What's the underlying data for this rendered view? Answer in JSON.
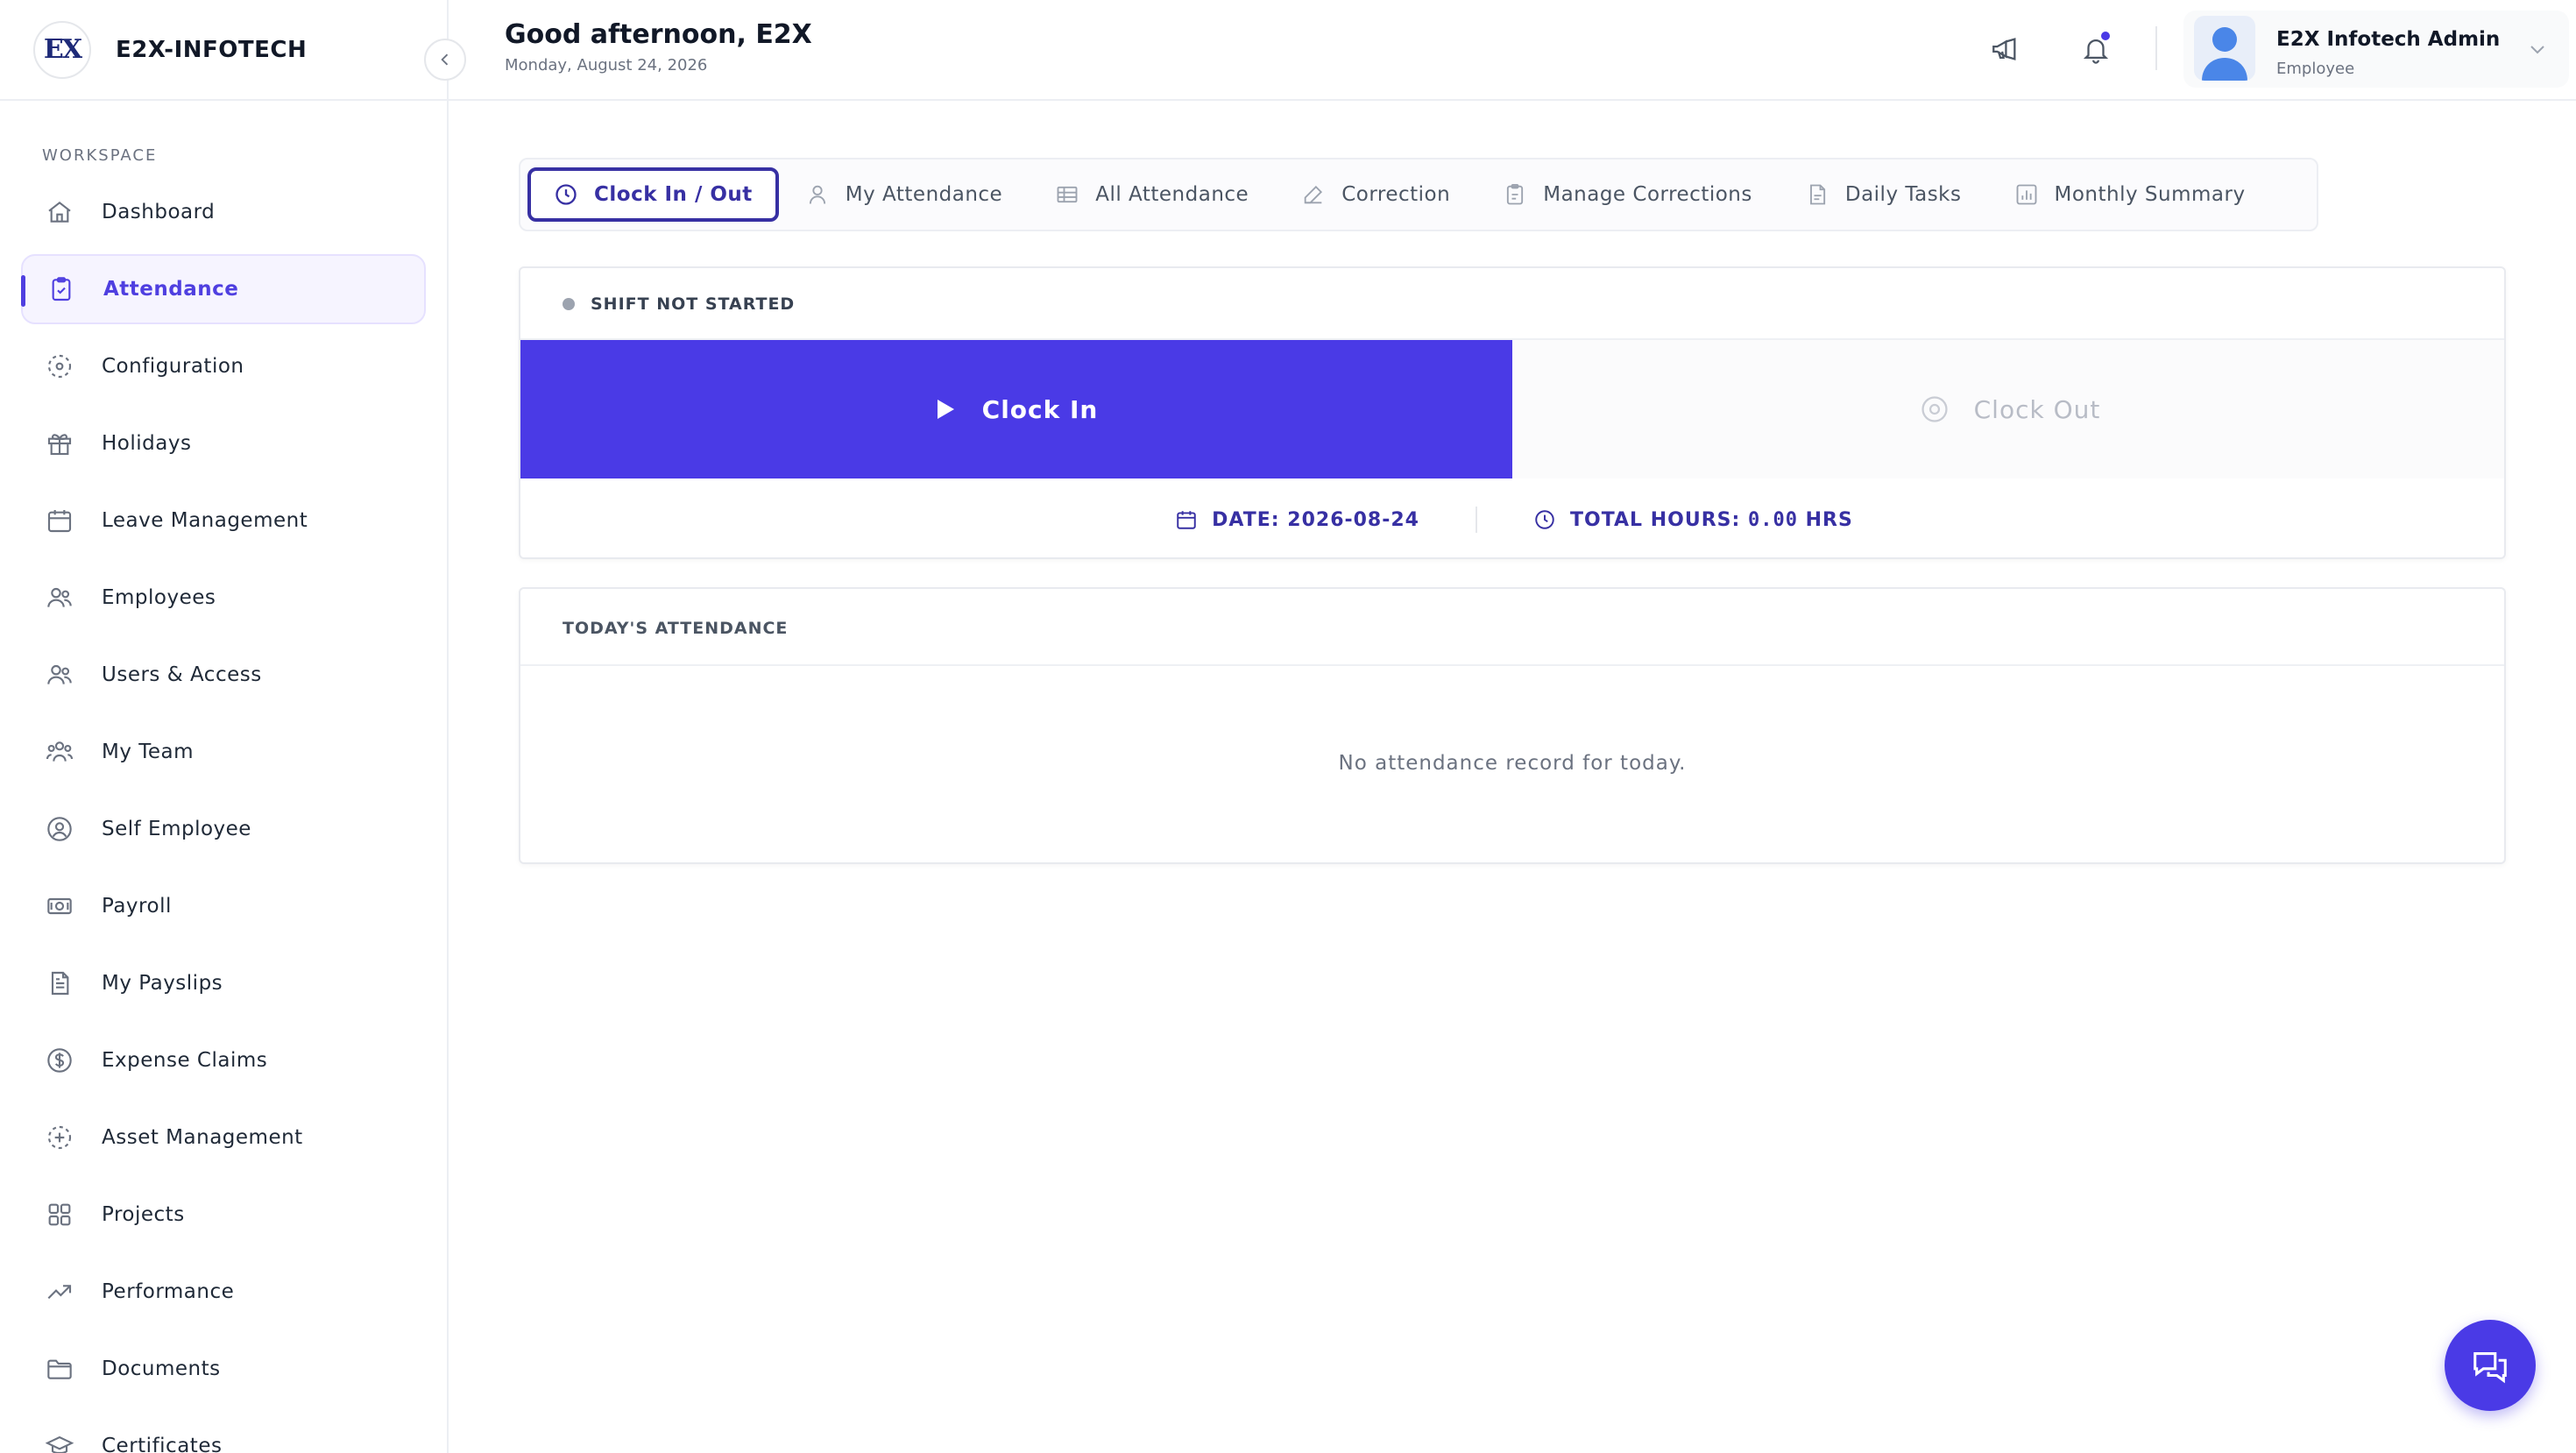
{
  "brand": {
    "name": "E2X-INFOTECH",
    "logo_text": "EX"
  },
  "sidebar": {
    "section_label": "WORKSPACE",
    "items": [
      {
        "label": "Dashboard",
        "icon": "home-icon"
      },
      {
        "label": "Attendance",
        "icon": "clipboard-check-icon",
        "active": true
      },
      {
        "label": "Configuration",
        "icon": "dashed-circle-icon"
      },
      {
        "label": "Holidays",
        "icon": "gift-icon"
      },
      {
        "label": "Leave Management",
        "icon": "calendar-icon"
      },
      {
        "label": "Employees",
        "icon": "users-icon"
      },
      {
        "label": "Users & Access",
        "icon": "users-icon"
      },
      {
        "label": "My Team",
        "icon": "team-icon"
      },
      {
        "label": "Self Employee",
        "icon": "user-circle-icon"
      },
      {
        "label": "Payroll",
        "icon": "banknote-icon"
      },
      {
        "label": "My Payslips",
        "icon": "file-text-icon"
      },
      {
        "label": "Expense Claims",
        "icon": "dollar-circle-icon"
      },
      {
        "label": "Asset Management",
        "icon": "dashed-circle-icon"
      },
      {
        "label": "Projects",
        "icon": "grid-icon"
      },
      {
        "label": "Performance",
        "icon": "trending-up-icon"
      },
      {
        "label": "Documents",
        "icon": "folder-icon"
      },
      {
        "label": "Certificates",
        "icon": "graduation-cap-icon"
      }
    ]
  },
  "header": {
    "greeting": "Good afternoon, E2X",
    "date": "Monday, August 24, 2026",
    "user": {
      "name": "E2X Infotech Admin",
      "role": "Employee"
    }
  },
  "tabs": [
    {
      "label": "Clock In / Out",
      "icon": "clock-icon",
      "active": true
    },
    {
      "label": "My Attendance",
      "icon": "user-icon"
    },
    {
      "label": "All Attendance",
      "icon": "table-icon"
    },
    {
      "label": "Correction",
      "icon": "edit-icon"
    },
    {
      "label": "Manage Corrections",
      "icon": "clipboard-icon"
    },
    {
      "label": "Daily Tasks",
      "icon": "file-icon"
    },
    {
      "label": "Monthly Summary",
      "icon": "chart-icon"
    }
  ],
  "clock": {
    "status": "SHIFT NOT STARTED",
    "clock_in_label": "Clock In",
    "clock_out_label": "Clock Out",
    "date_label": "DATE:",
    "date_value": "2026-08-24",
    "hours_label": "TOTAL HOURS:",
    "hours_value": "0.00",
    "hours_unit": "HRS"
  },
  "today": {
    "title": "TODAY'S ATTENDANCE",
    "empty_message": "No attendance record for today."
  },
  "colors": {
    "accent": "#4a3ae6",
    "accent_dark": "#3730a3",
    "muted": "#6b7280"
  }
}
